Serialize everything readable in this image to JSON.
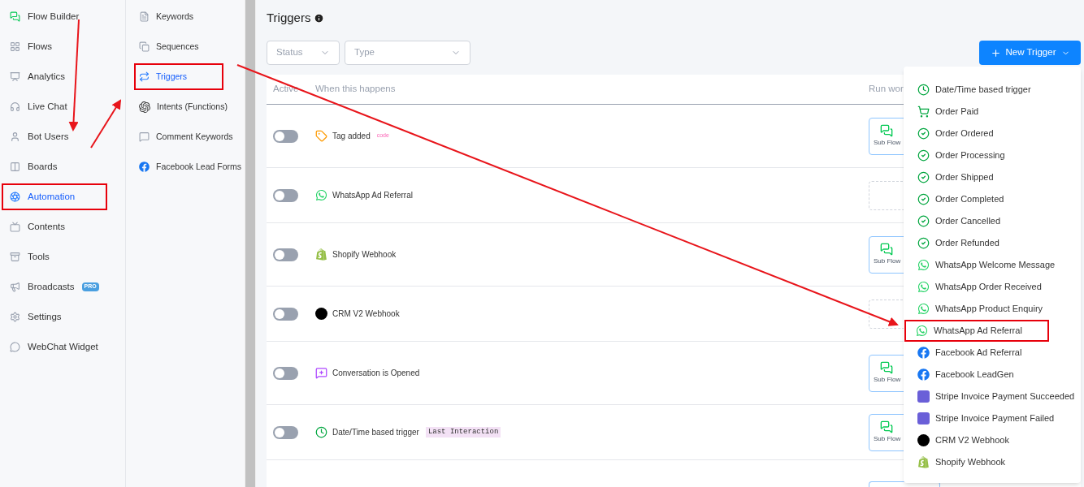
{
  "sidebar": {
    "items": [
      {
        "label": "Flow Builder",
        "selected": false,
        "annotated": false
      },
      {
        "label": "Flows",
        "selected": false,
        "annotated": false
      },
      {
        "label": "Analytics",
        "selected": false,
        "annotated": false
      },
      {
        "label": "Live Chat",
        "selected": false,
        "annotated": false
      },
      {
        "label": "Bot Users",
        "selected": false,
        "annotated": false
      },
      {
        "label": "Boards",
        "selected": false,
        "annotated": false
      },
      {
        "label": "Automation",
        "selected": true,
        "annotated": true
      },
      {
        "label": "Contents",
        "selected": false,
        "annotated": false
      },
      {
        "label": "Tools",
        "selected": false,
        "annotated": false
      },
      {
        "label": "Broadcasts",
        "selected": false,
        "annotated": false,
        "badge": "PRO"
      },
      {
        "label": "Settings",
        "selected": false,
        "annotated": false
      },
      {
        "label": "WebChat Widget",
        "selected": false,
        "annotated": false
      }
    ]
  },
  "submenu": {
    "items": [
      {
        "label": "Keywords",
        "selected": false,
        "annotated": false
      },
      {
        "label": "Sequences",
        "selected": false,
        "annotated": false
      },
      {
        "label": "Triggers",
        "selected": true,
        "annotated": true
      },
      {
        "label": "Intents (Functions)",
        "selected": false,
        "annotated": false
      },
      {
        "label": "Comment Keywords",
        "selected": false,
        "annotated": false
      },
      {
        "label": "Facebook Lead Forms",
        "selected": false,
        "annotated": false
      }
    ]
  },
  "page": {
    "title": "Triggers",
    "filters": [
      {
        "placeholder": "Status"
      },
      {
        "placeholder": "Type"
      }
    ],
    "new_button": "New Trigger"
  },
  "table": {
    "columns": [
      "Active",
      "When this happens",
      "Run wor"
    ],
    "rows": [
      {
        "kind": "tag",
        "on": false,
        "label": "Tag added",
        "tag": "code",
        "workflow": {
          "kind": "subflow",
          "label": "Sub Flow"
        }
      },
      {
        "kind": "whatsapp",
        "on": false,
        "label": "WhatsApp Ad Referral",
        "workflow": {
          "kind": "empty"
        }
      },
      {
        "kind": "shopify",
        "on": false,
        "label": "Shopify Webhook",
        "workflow": {
          "kind": "subflow",
          "label": "Sub Flow"
        }
      },
      {
        "kind": "crm",
        "on": false,
        "label": "CRM V2 Webhook",
        "workflow": {
          "kind": "empty"
        }
      },
      {
        "kind": "conversation",
        "on": false,
        "label": "Conversation is Opened",
        "workflow": {
          "kind": "subflow",
          "label": "Sub Flow"
        }
      },
      {
        "kind": "datetime",
        "on": false,
        "label": "Date/Time based trigger",
        "badge": "Last Interaction",
        "workflow": {
          "kind": "subflow",
          "label": "Sub Flow"
        }
      }
    ]
  },
  "dropdown": {
    "items": [
      {
        "kind": "datetime",
        "label": "Date/Time based trigger",
        "annotated": false
      },
      {
        "kind": "paid",
        "label": "Order Paid",
        "annotated": false
      },
      {
        "kind": "order",
        "label": "Order Ordered",
        "annotated": false
      },
      {
        "kind": "order",
        "label": "Order Processing",
        "annotated": false
      },
      {
        "kind": "order",
        "label": "Order Shipped",
        "annotated": false
      },
      {
        "kind": "order",
        "label": "Order Completed",
        "annotated": false
      },
      {
        "kind": "order",
        "label": "Order Cancelled",
        "annotated": false
      },
      {
        "kind": "order",
        "label": "Order Refunded",
        "annotated": false
      },
      {
        "kind": "whatsapp",
        "label": "WhatsApp Welcome Message",
        "annotated": false
      },
      {
        "kind": "whatsapp",
        "label": "WhatsApp Order Received",
        "annotated": false
      },
      {
        "kind": "whatsapp",
        "label": "WhatsApp Product Enquiry",
        "annotated": false
      },
      {
        "kind": "whatsapp",
        "label": "WhatsApp Ad Referral",
        "annotated": true
      },
      {
        "kind": "facebook",
        "label": "Facebook Ad Referral",
        "annotated": false
      },
      {
        "kind": "facebook",
        "label": "Facebook LeadGen",
        "annotated": false
      },
      {
        "kind": "stripe",
        "label": "Stripe Invoice Payment Succeeded",
        "annotated": false
      },
      {
        "kind": "stripe",
        "label": "Stripe Invoice Payment Failed",
        "annotated": false
      },
      {
        "kind": "crm",
        "label": "CRM V2 Webhook",
        "annotated": false
      },
      {
        "kind": "shopify",
        "label": "Shopify Webhook",
        "annotated": false
      }
    ]
  }
}
